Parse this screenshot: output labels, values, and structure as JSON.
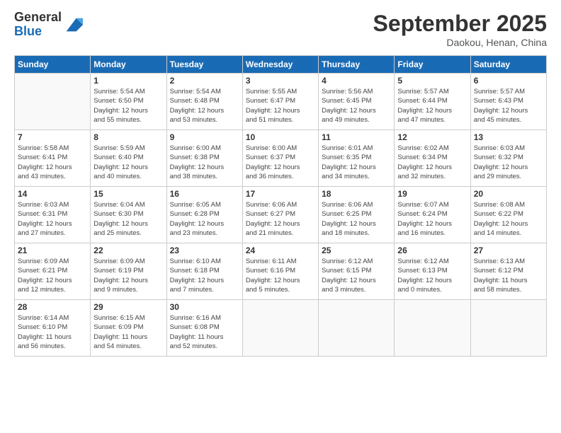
{
  "logo": {
    "general": "General",
    "blue": "Blue"
  },
  "header": {
    "month": "September 2025",
    "location": "Daokou, Henan, China"
  },
  "weekdays": [
    "Sunday",
    "Monday",
    "Tuesday",
    "Wednesday",
    "Thursday",
    "Friday",
    "Saturday"
  ],
  "weeks": [
    [
      {
        "day": "",
        "info": ""
      },
      {
        "day": "1",
        "info": "Sunrise: 5:54 AM\nSunset: 6:50 PM\nDaylight: 12 hours\nand 55 minutes."
      },
      {
        "day": "2",
        "info": "Sunrise: 5:54 AM\nSunset: 6:48 PM\nDaylight: 12 hours\nand 53 minutes."
      },
      {
        "day": "3",
        "info": "Sunrise: 5:55 AM\nSunset: 6:47 PM\nDaylight: 12 hours\nand 51 minutes."
      },
      {
        "day": "4",
        "info": "Sunrise: 5:56 AM\nSunset: 6:45 PM\nDaylight: 12 hours\nand 49 minutes."
      },
      {
        "day": "5",
        "info": "Sunrise: 5:57 AM\nSunset: 6:44 PM\nDaylight: 12 hours\nand 47 minutes."
      },
      {
        "day": "6",
        "info": "Sunrise: 5:57 AM\nSunset: 6:43 PM\nDaylight: 12 hours\nand 45 minutes."
      }
    ],
    [
      {
        "day": "7",
        "info": "Sunrise: 5:58 AM\nSunset: 6:41 PM\nDaylight: 12 hours\nand 43 minutes."
      },
      {
        "day": "8",
        "info": "Sunrise: 5:59 AM\nSunset: 6:40 PM\nDaylight: 12 hours\nand 40 minutes."
      },
      {
        "day": "9",
        "info": "Sunrise: 6:00 AM\nSunset: 6:38 PM\nDaylight: 12 hours\nand 38 minutes."
      },
      {
        "day": "10",
        "info": "Sunrise: 6:00 AM\nSunset: 6:37 PM\nDaylight: 12 hours\nand 36 minutes."
      },
      {
        "day": "11",
        "info": "Sunrise: 6:01 AM\nSunset: 6:35 PM\nDaylight: 12 hours\nand 34 minutes."
      },
      {
        "day": "12",
        "info": "Sunrise: 6:02 AM\nSunset: 6:34 PM\nDaylight: 12 hours\nand 32 minutes."
      },
      {
        "day": "13",
        "info": "Sunrise: 6:03 AM\nSunset: 6:32 PM\nDaylight: 12 hours\nand 29 minutes."
      }
    ],
    [
      {
        "day": "14",
        "info": "Sunrise: 6:03 AM\nSunset: 6:31 PM\nDaylight: 12 hours\nand 27 minutes."
      },
      {
        "day": "15",
        "info": "Sunrise: 6:04 AM\nSunset: 6:30 PM\nDaylight: 12 hours\nand 25 minutes."
      },
      {
        "day": "16",
        "info": "Sunrise: 6:05 AM\nSunset: 6:28 PM\nDaylight: 12 hours\nand 23 minutes."
      },
      {
        "day": "17",
        "info": "Sunrise: 6:06 AM\nSunset: 6:27 PM\nDaylight: 12 hours\nand 21 minutes."
      },
      {
        "day": "18",
        "info": "Sunrise: 6:06 AM\nSunset: 6:25 PM\nDaylight: 12 hours\nand 18 minutes."
      },
      {
        "day": "19",
        "info": "Sunrise: 6:07 AM\nSunset: 6:24 PM\nDaylight: 12 hours\nand 16 minutes."
      },
      {
        "day": "20",
        "info": "Sunrise: 6:08 AM\nSunset: 6:22 PM\nDaylight: 12 hours\nand 14 minutes."
      }
    ],
    [
      {
        "day": "21",
        "info": "Sunrise: 6:09 AM\nSunset: 6:21 PM\nDaylight: 12 hours\nand 12 minutes."
      },
      {
        "day": "22",
        "info": "Sunrise: 6:09 AM\nSunset: 6:19 PM\nDaylight: 12 hours\nand 9 minutes."
      },
      {
        "day": "23",
        "info": "Sunrise: 6:10 AM\nSunset: 6:18 PM\nDaylight: 12 hours\nand 7 minutes."
      },
      {
        "day": "24",
        "info": "Sunrise: 6:11 AM\nSunset: 6:16 PM\nDaylight: 12 hours\nand 5 minutes."
      },
      {
        "day": "25",
        "info": "Sunrise: 6:12 AM\nSunset: 6:15 PM\nDaylight: 12 hours\nand 3 minutes."
      },
      {
        "day": "26",
        "info": "Sunrise: 6:12 AM\nSunset: 6:13 PM\nDaylight: 12 hours\nand 0 minutes."
      },
      {
        "day": "27",
        "info": "Sunrise: 6:13 AM\nSunset: 6:12 PM\nDaylight: 11 hours\nand 58 minutes."
      }
    ],
    [
      {
        "day": "28",
        "info": "Sunrise: 6:14 AM\nSunset: 6:10 PM\nDaylight: 11 hours\nand 56 minutes."
      },
      {
        "day": "29",
        "info": "Sunrise: 6:15 AM\nSunset: 6:09 PM\nDaylight: 11 hours\nand 54 minutes."
      },
      {
        "day": "30",
        "info": "Sunrise: 6:16 AM\nSunset: 6:08 PM\nDaylight: 11 hours\nand 52 minutes."
      },
      {
        "day": "",
        "info": ""
      },
      {
        "day": "",
        "info": ""
      },
      {
        "day": "",
        "info": ""
      },
      {
        "day": "",
        "info": ""
      }
    ]
  ]
}
